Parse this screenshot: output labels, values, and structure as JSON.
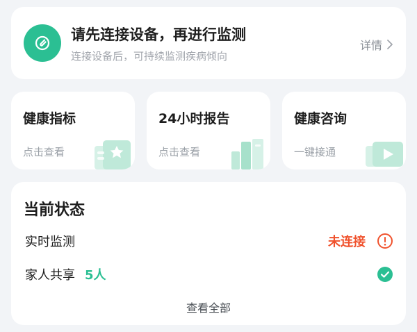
{
  "connect": {
    "title": "请先连接设备，再进行监测",
    "subtitle": "连接设备后，可持续监测疾病倾向",
    "detail_label": "详情",
    "icon": "paperclip-icon"
  },
  "features": [
    {
      "title": "健康指标",
      "subtitle": "点击查看",
      "icon": "star-card-icon"
    },
    {
      "title": "24小时报告",
      "subtitle": "点击查看",
      "icon": "report-bars-icon"
    },
    {
      "title": "健康咨询",
      "subtitle": "一键接通",
      "icon": "play-card-icon"
    }
  ],
  "status": {
    "title": "当前状态",
    "rows": [
      {
        "label": "实时监测",
        "status": "未连接",
        "icon": "warning-circle-icon"
      },
      {
        "label": "家人共享",
        "count": "5人",
        "icon": "check-circle-icon"
      }
    ],
    "view_all_label": "查看全部"
  },
  "colors": {
    "accent": "#2bbf93",
    "warning": "#f0522d",
    "background": "#f2f4f7"
  }
}
